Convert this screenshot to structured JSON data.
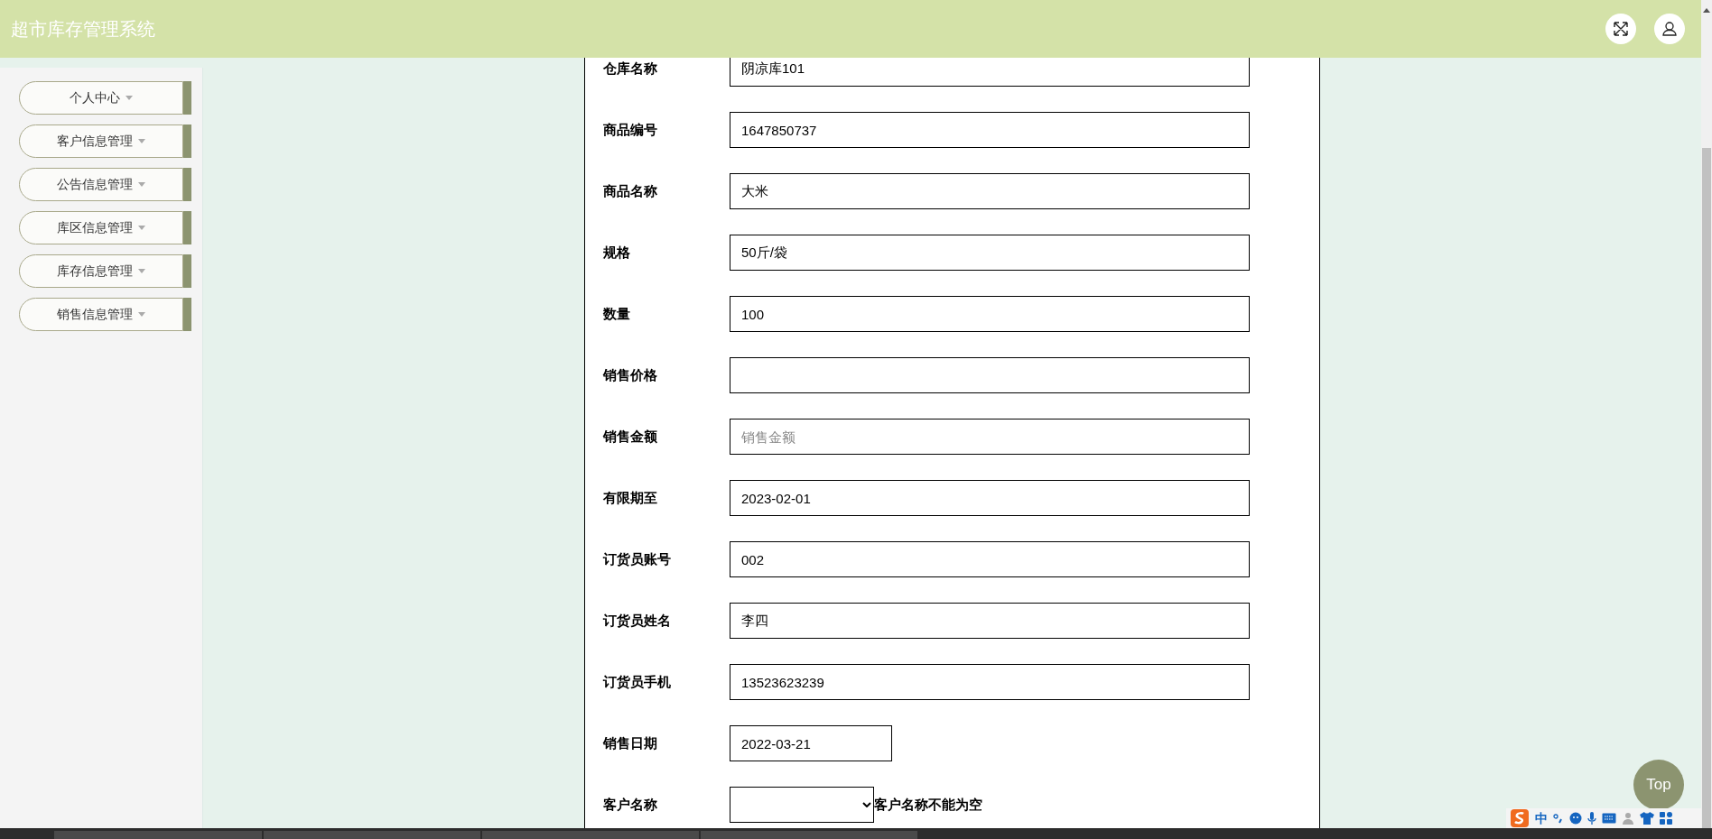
{
  "header": {
    "title": "超市库存管理系统"
  },
  "sidebar": {
    "items": [
      {
        "label": "个人中心"
      },
      {
        "label": "客户信息管理"
      },
      {
        "label": "公告信息管理"
      },
      {
        "label": "库区信息管理"
      },
      {
        "label": "库存信息管理"
      },
      {
        "label": "销售信息管理"
      }
    ]
  },
  "form": {
    "fields": [
      {
        "label": "仓库名称",
        "kind": "text",
        "value": "阴凉库101"
      },
      {
        "label": "商品编号",
        "kind": "text",
        "value": "1647850737"
      },
      {
        "label": "商品名称",
        "kind": "text",
        "value": "大米"
      },
      {
        "label": "规格",
        "kind": "text",
        "value": "50斤/袋"
      },
      {
        "label": "数量",
        "kind": "text",
        "value": "100"
      },
      {
        "label": "销售价格",
        "kind": "text"
      },
      {
        "label": "销售金额",
        "kind": "text",
        "placeholder": "销售金额"
      },
      {
        "label": "有限期至",
        "kind": "text",
        "value": "2023-02-01"
      },
      {
        "label": "订货员账号",
        "kind": "text",
        "value": "002"
      },
      {
        "label": "订货员姓名",
        "kind": "text",
        "value": "李四"
      },
      {
        "label": "订货员手机",
        "kind": "text",
        "value": "13523623239"
      },
      {
        "label": "销售日期",
        "kind": "date",
        "value": "2022-03-21"
      },
      {
        "label": "客户名称",
        "kind": "select",
        "error": "客户名称不能为空"
      }
    ]
  },
  "top_button": {
    "label": "Top"
  },
  "ime_bar": {
    "mode": "中"
  }
}
